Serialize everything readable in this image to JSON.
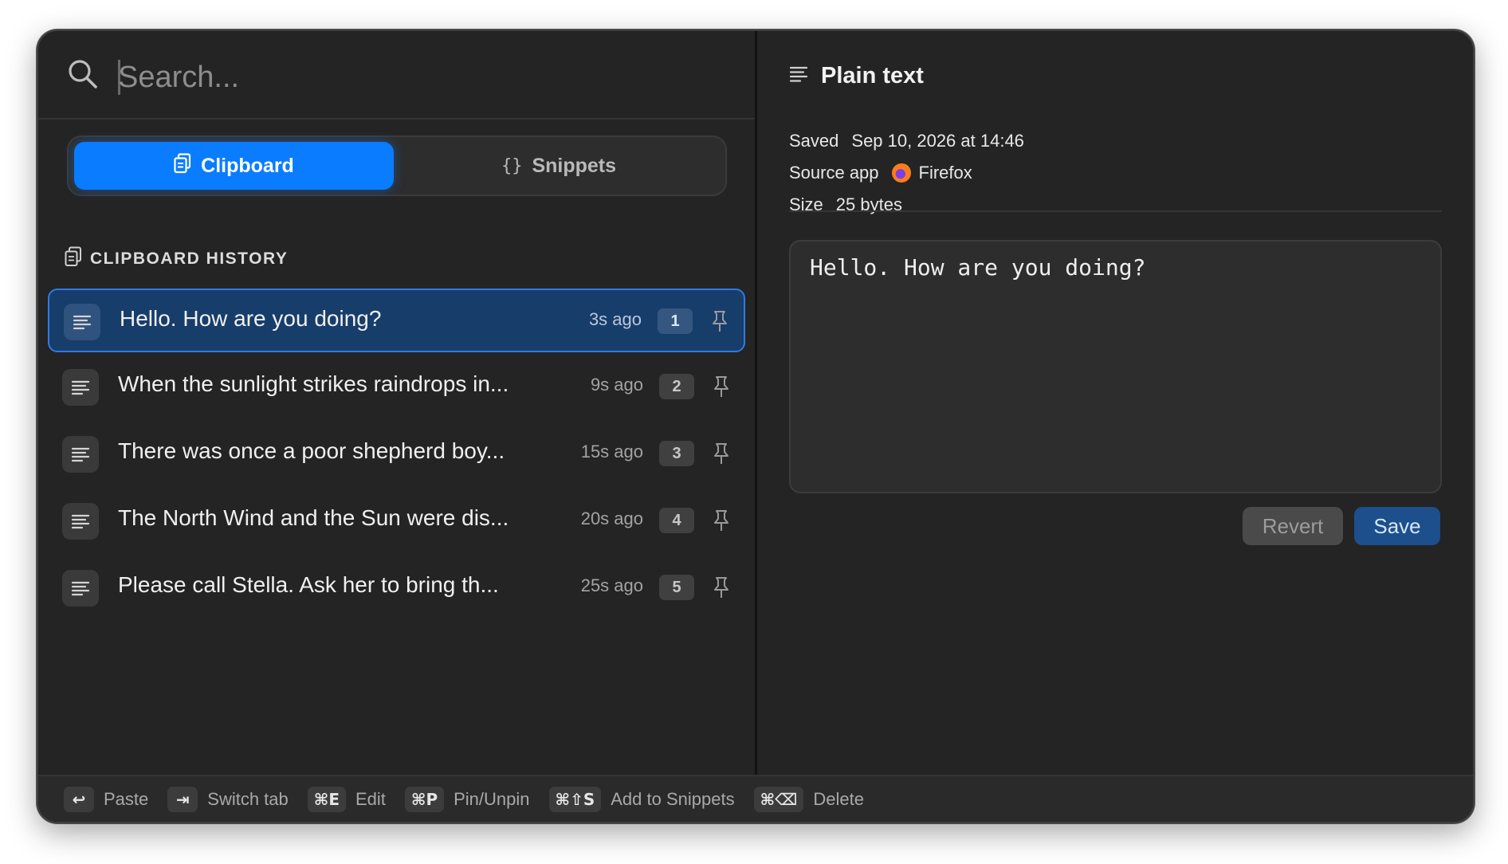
{
  "search": {
    "placeholder": "Search...",
    "value": ""
  },
  "tabs": [
    {
      "label": "Clipboard",
      "icon": "clipboard-icon",
      "active": true
    },
    {
      "label": "Snippets",
      "icon": "braces-icon",
      "active": false
    }
  ],
  "section": {
    "title": "CLIPBOARD HISTORY",
    "icon": "clipboard-icon"
  },
  "items": [
    {
      "text": "Hello. How are you doing?",
      "time": "3s ago",
      "index": "1",
      "selected": true
    },
    {
      "text": "When the sunlight strikes raindrops in...",
      "time": "9s ago",
      "index": "2"
    },
    {
      "text": "There was once a poor shepherd boy...",
      "time": "15s ago",
      "index": "3"
    },
    {
      "text": "The North Wind and the Sun were dis...",
      "time": "20s ago",
      "index": "4"
    },
    {
      "text": "Please call Stella. Ask her to bring th...",
      "time": "25s ago",
      "index": "5"
    }
  ],
  "detail": {
    "title": "Plain text",
    "saved_label": "Saved",
    "saved_value": "Sep 10, 2026 at 14:46",
    "source_label": "Source app",
    "source_value": "Firefox",
    "size_label": "Size",
    "size_value": "25 bytes",
    "content": "Hello. How are you doing?",
    "revert_label": "Revert",
    "save_label": "Save"
  },
  "footer": [
    {
      "key": "↩",
      "label": "Paste"
    },
    {
      "key": "⇥",
      "label": "Switch tab"
    },
    {
      "key": "⌘E",
      "label": "Edit"
    },
    {
      "key": "⌘P",
      "label": "Pin/Unpin"
    },
    {
      "key": "⌘⇧S",
      "label": "Add to Snippets"
    },
    {
      "key": "⌘⌫",
      "label": "Delete"
    }
  ],
  "colors": {
    "accent": "#0a7cff",
    "selected_row": "#173d6b",
    "background": "#242424"
  }
}
